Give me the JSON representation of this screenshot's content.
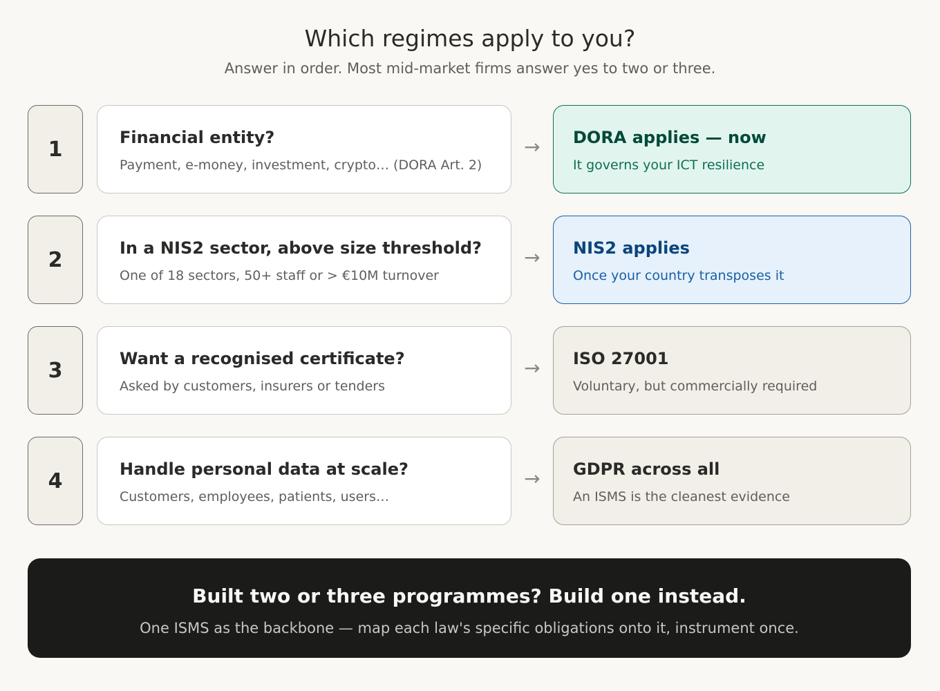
{
  "header": {
    "title": "Which regimes apply to you?",
    "subtitle": "Answer in order. Most mid-market firms answer yes to two or three."
  },
  "arrow_glyph": "→",
  "rows": [
    {
      "number": "1",
      "question": "Financial entity?",
      "question_detail": "Payment, e-money, investment, crypto… (DORA Art. 2)",
      "result": "DORA applies — now",
      "result_detail": "It governs your ICT resilience",
      "result_style": "green"
    },
    {
      "number": "2",
      "question": "In a NIS2 sector, above size threshold?",
      "question_detail": "One of 18 sectors, 50+ staff or > €10M turnover",
      "result": "NIS2 applies",
      "result_detail": "Once your country transposes it",
      "result_style": "blue"
    },
    {
      "number": "3",
      "question": "Want a recognised certificate?",
      "question_detail": "Asked by customers, insurers or tenders",
      "result": "ISO 27001",
      "result_detail": "Voluntary, but commercially required",
      "result_style": "gray"
    },
    {
      "number": "4",
      "question": "Handle personal data at scale?",
      "question_detail": "Customers, employees, patients, users…",
      "result": "GDPR across all",
      "result_detail": "An ISMS is the cleanest evidence",
      "result_style": "gray"
    }
  ],
  "banner": {
    "title": "Built two or three programmes? Build one instead.",
    "subtitle": "One ISMS as the backbone — map each law's specific obligations onto it, instrument once."
  },
  "colors": {
    "background": "#f9f8f4",
    "green_fill": "#e1f5ee",
    "green_accent": "#0f6e56",
    "blue_fill": "#e6f1fb",
    "blue_accent": "#185fa5",
    "neutral_fill": "#f1efe8",
    "banner_fill": "#1b1b1a"
  }
}
